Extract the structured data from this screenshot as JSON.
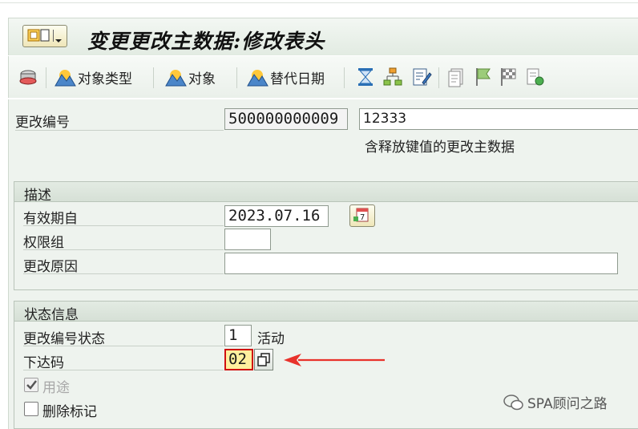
{
  "title": "变更更改主数据:修改表头",
  "toolbar": {
    "object_types": "对象类型",
    "objects": "对象",
    "alt_dates": "替代日期"
  },
  "header": {
    "change_number_label": "更改编号",
    "change_number_value": "500000000009",
    "description_value": "12333",
    "note": "含释放键值的更改主数据"
  },
  "desc_group": {
    "title": "描述",
    "valid_from_label": "有效期自",
    "valid_from_value": "2023.07.16",
    "auth_group_label": "权限组",
    "auth_group_value": "",
    "reason_label": "更改原因",
    "reason_value": ""
  },
  "status_group": {
    "title": "状态信息",
    "status_label": "更改编号状态",
    "status_value": "1",
    "status_text": "活动",
    "release_key_label": "下达码",
    "release_key_value": "02",
    "usage_label": "用途",
    "usage_checked": true,
    "delete_flag_label": "删除标记",
    "delete_flag_checked": false
  },
  "watermark": "SPA顾问之路",
  "colors": {
    "arrow": "#e8322b",
    "highlight": "#ffef9e",
    "focus_border": "#d01010"
  }
}
